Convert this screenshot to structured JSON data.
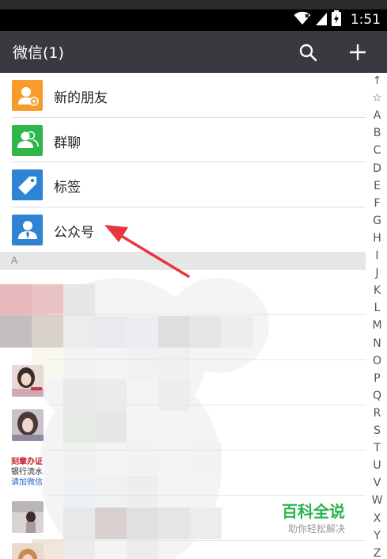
{
  "status_bar": {
    "time": "1:51"
  },
  "header": {
    "title": "微信(1)"
  },
  "menu_items": [
    {
      "label": "新的朋友",
      "icon": "add-friend-icon",
      "color": "#f79c2a"
    },
    {
      "label": "群聊",
      "icon": "group-chat-icon",
      "color": "#2fb74c"
    },
    {
      "label": "标签",
      "icon": "tag-icon",
      "color": "#2f83d3"
    },
    {
      "label": "公众号",
      "icon": "official-account-icon",
      "color": "#2f83d3"
    }
  ],
  "section": {
    "letter": "A"
  },
  "ad": {
    "line1": "刻章办证",
    "line2": "银行流水",
    "line3": "请加微信"
  },
  "index": [
    "↑",
    "☆",
    "A",
    "B",
    "C",
    "D",
    "E",
    "F",
    "G",
    "H",
    "I",
    "J",
    "K",
    "L",
    "M",
    "N",
    "O",
    "P",
    "Q",
    "R",
    "S",
    "T",
    "U",
    "V",
    "W",
    "X",
    "Y",
    "Z"
  ],
  "watermark": {
    "title": "百科全说",
    "subtitle": "助你轻松解决"
  },
  "colors": {
    "actionbar": "#393a3f",
    "accent_green": "#2bb34a",
    "arrow": "#e8373c"
  }
}
